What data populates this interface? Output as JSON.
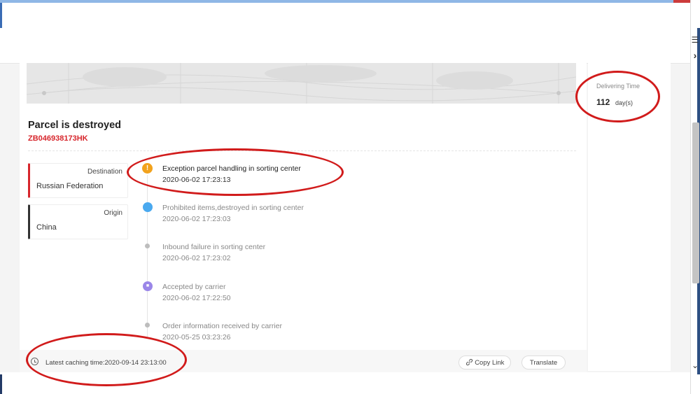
{
  "parcel": {
    "status_title": "Parcel is destroyed",
    "tracking_number": "ZB046938173HK",
    "destination_label": "Destination",
    "destination_value": "Russian Federation",
    "origin_label": "Origin",
    "origin_value": "China"
  },
  "events": [
    {
      "title": "Exception parcel handling in sorting center",
      "time": "2020-06-02 17:23:13",
      "icon": "exclamation-icon"
    },
    {
      "title": "Prohibited items,destroyed in sorting center",
      "time": "2020-06-02 17:23:03",
      "icon": "blue-dot"
    },
    {
      "title": "Inbound failure in sorting center",
      "time": "2020-06-02 17:23:02",
      "icon": "gray-dot"
    },
    {
      "title": "Accepted by carrier",
      "time": "2020-06-02 17:22:50",
      "icon": "truck-icon"
    },
    {
      "title": "Order information received by carrier",
      "time": "2020-05-25 03:23:26",
      "icon": "gray-dot"
    }
  ],
  "delivering": {
    "label": "Delivering Time",
    "value": "112",
    "unit": "day(s)"
  },
  "footer": {
    "cache_text": "Latest caching time:2020-09-14 23:13:00",
    "copy_link": "Copy Link",
    "translate": "Translate"
  },
  "browser": {
    "menu_glyph": "☰",
    "chevron_right": "›",
    "chevron_down": "⌄"
  },
  "colors": {
    "accent_red": "#d7262c",
    "annotation_red": "#d11b1b",
    "exception_orange": "#f2a21c",
    "current_blue": "#4aa9ef",
    "carrier_purple": "#9a86e8"
  }
}
